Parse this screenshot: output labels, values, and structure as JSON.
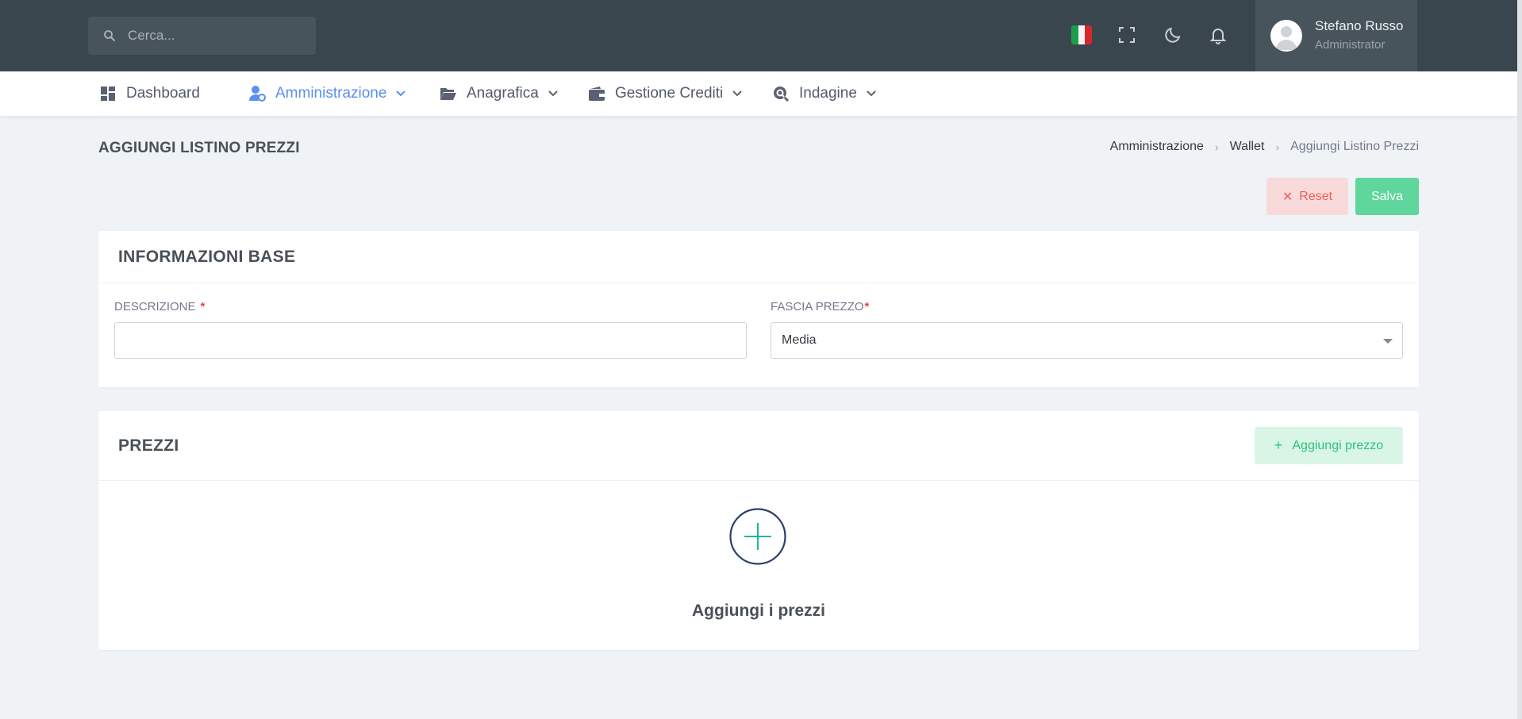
{
  "topbar": {
    "search_placeholder": "Cerca...",
    "user": {
      "name": "Stefano Russo",
      "role": "Administrator"
    },
    "icons": [
      "italy-flag",
      "fullscreen-icon",
      "moon-icon",
      "bell-icon"
    ],
    "colors": {
      "bg": "#3a464d",
      "user_bg": "#48545b"
    }
  },
  "nav": {
    "items": [
      {
        "label": "Dashboard",
        "icon": "dashboard-icon",
        "active": false
      },
      {
        "label": "Amministrazione",
        "icon": "user-admin-icon",
        "active": true
      },
      {
        "label": "Anagrafica",
        "icon": "folder-open-icon",
        "active": false
      },
      {
        "label": "Gestione Crediti",
        "icon": "wallet-icon",
        "active": false
      },
      {
        "label": "Indagine",
        "icon": "search-circle-icon",
        "active": false
      }
    ]
  },
  "page": {
    "title": "AGGIUNGI LISTINO PREZZI",
    "breadcrumb": [
      "Amministrazione",
      "Wallet",
      "Aggiungi Listino Prezzi"
    ],
    "actions": {
      "reset_label": "Reset",
      "save_label": "Salva"
    }
  },
  "info_card": {
    "title": "INFORMAZIONI BASE",
    "descrizione": {
      "label": "DESCRIZIONE",
      "required_mark": "*",
      "value": ""
    },
    "fascia": {
      "label": "FASCIA PREZZO",
      "required_mark": "*",
      "selected": "Media"
    }
  },
  "prices_card": {
    "title": "PREZZI",
    "add_label": "Aggiungi prezzo",
    "empty_text": "Aggiungi i prezzi"
  },
  "colors": {
    "accent": "#5b8ef0",
    "success": "#5fd69b",
    "danger": "#f15c5c",
    "page_bg": "#eff3f6"
  }
}
